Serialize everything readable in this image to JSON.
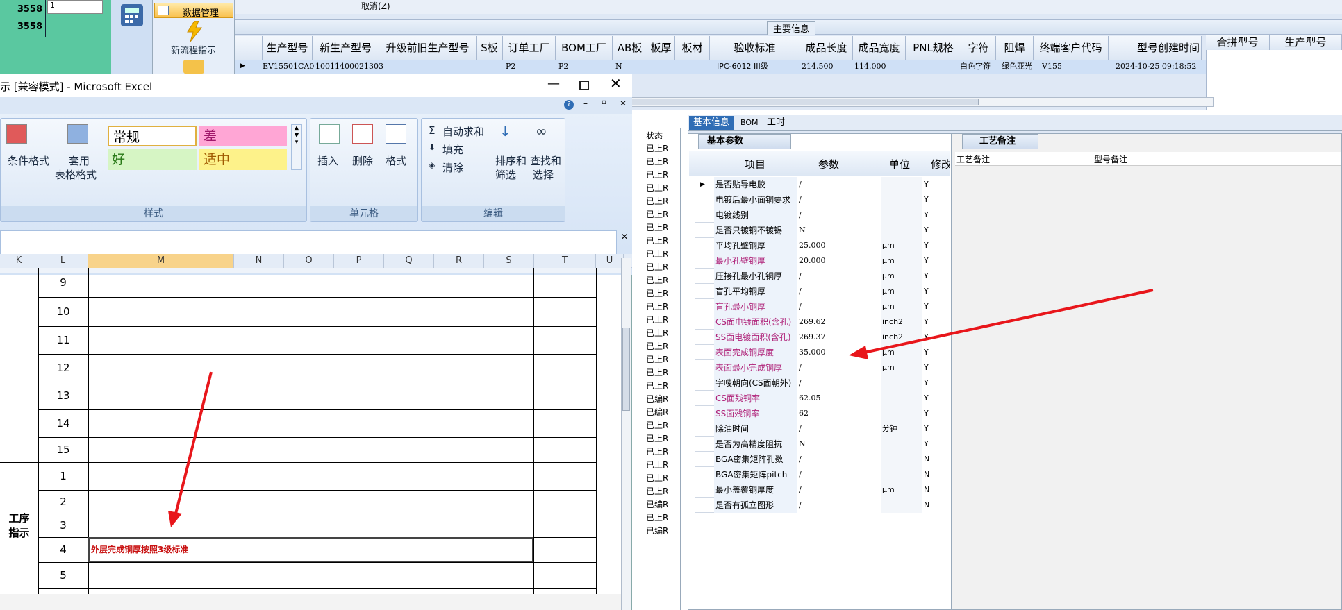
{
  "topleft": {
    "rows": [
      {
        "value": "3558",
        "input": "1"
      },
      {
        "value": "3558"
      }
    ]
  },
  "nav": {
    "data_mgmt": "数据管理",
    "new_flow": "新流程指示"
  },
  "topgrid": {
    "cancel": "取消(Z)",
    "section_title": "主要信息",
    "headers": [
      "生产型号",
      "新生产型号",
      "升级前旧生产型号",
      "S板",
      "订单工厂",
      "BOM工厂",
      "AB板",
      "板厚",
      "板材",
      "验收标准",
      "成品长度",
      "成品宽度",
      "PNL规格",
      "字符",
      "阻焊",
      "终端客户代码",
      "型号创建时间",
      "合拼型号",
      "生产型号"
    ],
    "row": {
      "model": "EV15501CA0",
      "new_model": "10011400021303",
      "order_factory": "P2",
      "bom_factory": "P2",
      "ab": "N",
      "standard": "IPC-6012 III级",
      "length": "214.500",
      "width": "114.000",
      "char": "白色字符",
      "solder": "绿色亚光",
      "customer": "V155",
      "created": "2024-10-25 09:18:52"
    }
  },
  "excel": {
    "title": "示 [兼容模式] - Microsoft Excel",
    "buttons": {
      "cond_format": "条件格式",
      "table_format": "套用",
      "table_format2": "表格格式",
      "insert": "插入",
      "delete": "删除",
      "format": "格式",
      "autosum": "自动求和",
      "fill": "填充",
      "clear": "清除",
      "sort": "排序和",
      "sort2": "筛选",
      "find": "查找和",
      "find2": "选择"
    },
    "styles": {
      "normal": "常规",
      "bad": "差",
      "good": "好",
      "neutral": "适中"
    },
    "groups": {
      "styles": "样式",
      "cells": "单元格",
      "edit": "编辑"
    },
    "columns": [
      "K",
      "L",
      "M",
      "N",
      "O",
      "P",
      "Q",
      "R",
      "S",
      "T",
      "U"
    ],
    "rows_a": [
      "9",
      "10",
      "11",
      "12",
      "13",
      "14",
      "15"
    ],
    "rows_b": [
      "1",
      "2",
      "3",
      "4",
      "5"
    ],
    "merged_label": "工序\n指示",
    "note": "外层完成铜厚按照3级标准"
  },
  "status": {
    "header": "状态",
    "items": [
      "已上R",
      "已上R",
      "已上R",
      "已上R",
      "已上R",
      "已上R",
      "已上R",
      "已上R",
      "已上R",
      "已上R",
      "已上R",
      "已上R",
      "已上R",
      "已上R",
      "已上R",
      "已上R",
      "已上R",
      "已上R",
      "已上R",
      "已编R",
      "已编R",
      "已上R",
      "已上R",
      "已上R",
      "已上R",
      "已上R",
      "已上R",
      "已编R",
      "已上R",
      "已编R"
    ]
  },
  "panel": {
    "tabs": [
      "基本信息",
      "BOM",
      "工时"
    ],
    "sub_tab": "基本参数",
    "right_tab": "工艺备注",
    "right_cols": [
      "工艺备注",
      "型号备注"
    ],
    "cols": [
      "项目",
      "参数",
      "单位",
      "修改"
    ],
    "rows": [
      {
        "item": "是否贴导电胶",
        "param": "/",
        "unit": "",
        "mod": "Y",
        "purple": false
      },
      {
        "item": "电镀后最小面铜要求",
        "param": "/",
        "unit": "",
        "mod": "Y",
        "purple": false
      },
      {
        "item": "电镀线别",
        "param": "/",
        "unit": "",
        "mod": "Y",
        "purple": false
      },
      {
        "item": "是否只镀铜不镀锡",
        "param": "N",
        "unit": "",
        "mod": "Y",
        "purple": false
      },
      {
        "item": "平均孔壁铜厚",
        "param": "25.000",
        "unit": "μm",
        "mod": "Y",
        "purple": false
      },
      {
        "item": "最小孔壁铜厚",
        "param": "20.000",
        "unit": "μm",
        "mod": "Y",
        "purple": true
      },
      {
        "item": "压接孔最小孔铜厚",
        "param": "/",
        "unit": "μm",
        "mod": "Y",
        "purple": false
      },
      {
        "item": "盲孔平均铜厚",
        "param": "/",
        "unit": "μm",
        "mod": "Y",
        "purple": false
      },
      {
        "item": "盲孔最小铜厚",
        "param": "/",
        "unit": "μm",
        "mod": "Y",
        "purple": true
      },
      {
        "item": "CS面电镀面积(含孔)",
        "param": "269.62",
        "unit": "inch2",
        "mod": "Y",
        "purple": true
      },
      {
        "item": "SS面电镀面积(含孔)",
        "param": "269.37",
        "unit": "inch2",
        "mod": "Y",
        "purple": true
      },
      {
        "item": "表面完成铜厚度",
        "param": "35.000",
        "unit": "μm",
        "mod": "Y",
        "purple": true
      },
      {
        "item": "表面最小完成铜厚",
        "param": "/",
        "unit": "μm",
        "mod": "Y",
        "purple": true
      },
      {
        "item": "字唛朝向(CS面朝外)",
        "param": "/",
        "unit": "",
        "mod": "Y",
        "purple": false
      },
      {
        "item": "CS面残铜率",
        "param": "62.05",
        "unit": "",
        "mod": "Y",
        "purple": true
      },
      {
        "item": "SS面残铜率",
        "param": "62",
        "unit": "",
        "mod": "Y",
        "purple": true
      },
      {
        "item": "除油时间",
        "param": "/",
        "unit": "分钟",
        "mod": "Y",
        "purple": false
      },
      {
        "item": "是否为高精度阻抗",
        "param": "N",
        "unit": "",
        "mod": "Y",
        "purple": false
      },
      {
        "item": "BGA密集矩阵孔数",
        "param": "/",
        "unit": "",
        "mod": "N",
        "purple": false
      },
      {
        "item": "BGA密集矩阵pitch",
        "param": "/",
        "unit": "",
        "mod": "N",
        "purple": false
      },
      {
        "item": "最小盖覆铜厚度",
        "param": "/",
        "unit": "μm",
        "mod": "N",
        "purple": false
      },
      {
        "item": "是否有孤立图形",
        "param": "/",
        "unit": "",
        "mod": "N",
        "purple": false
      }
    ]
  },
  "colors": {
    "arrow": "#e8161b",
    "purple": "#b0247a",
    "accent": "#2f6db5"
  }
}
